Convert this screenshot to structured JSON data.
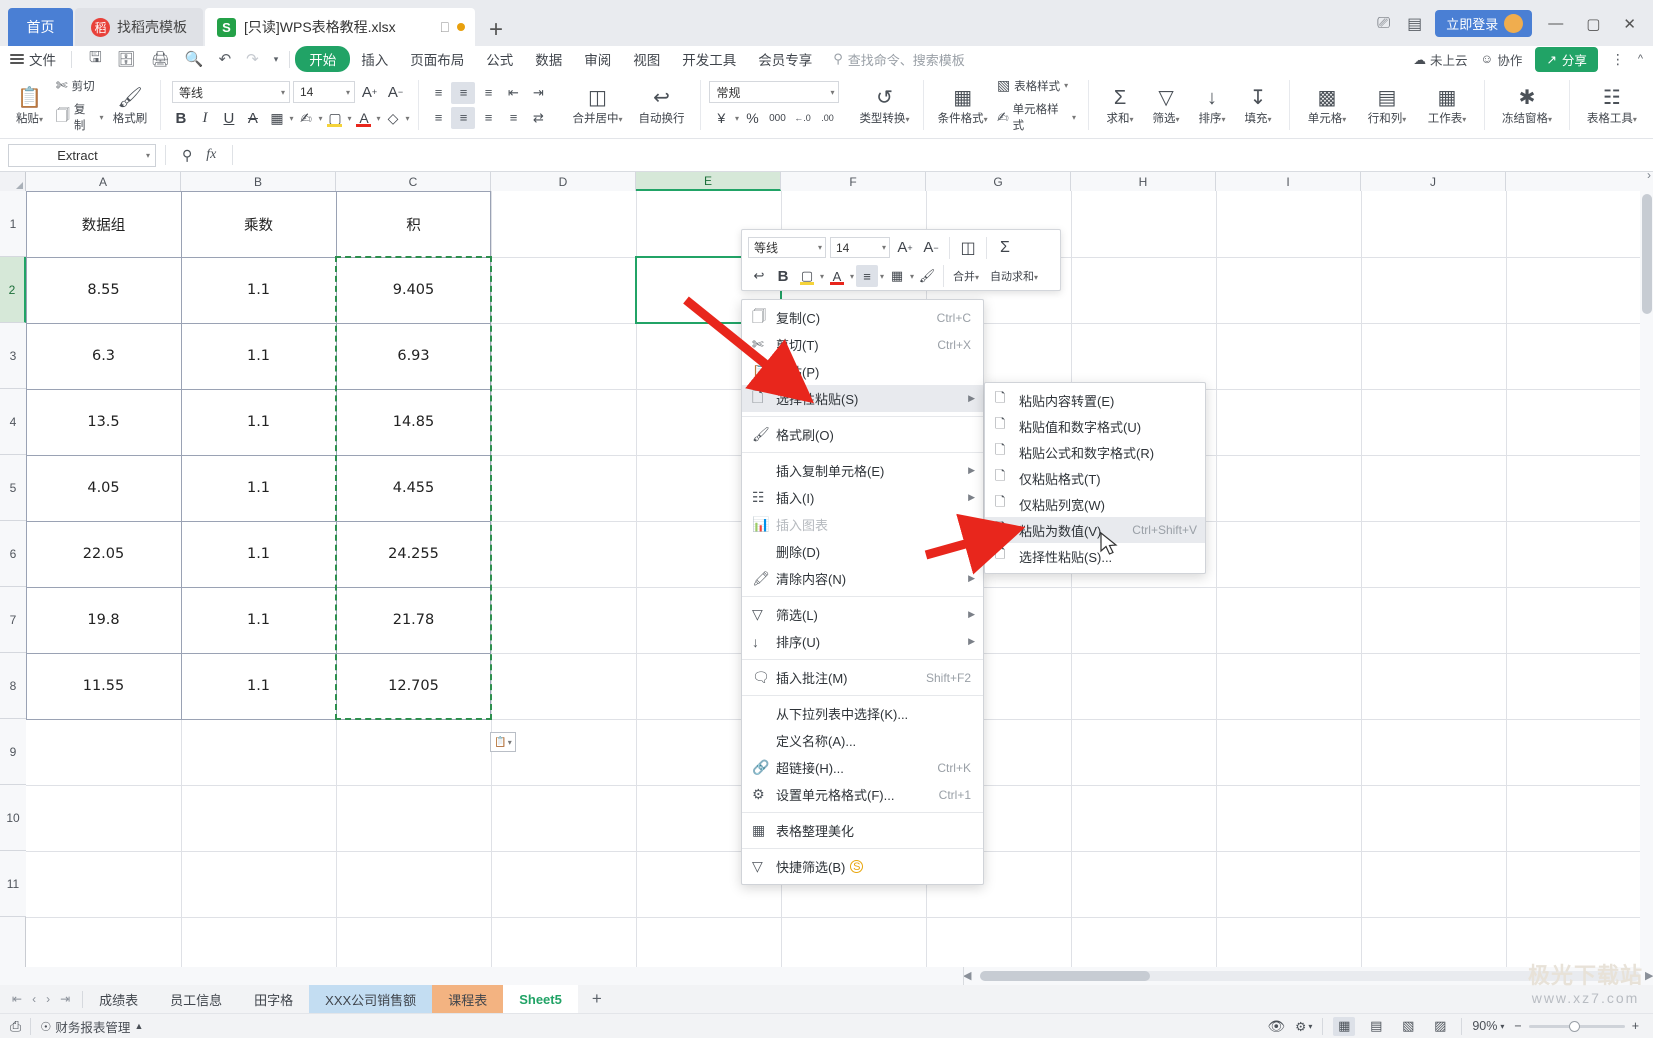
{
  "titlebar": {
    "home_tab": "首页",
    "template_tab": "找稻壳模板",
    "template_logo": "稻",
    "doc_tab": "[只读]WPS表格教程.xlsx",
    "doc_logo": "S",
    "new_tab_icon": "plus-icon",
    "login_label": "立即登录",
    "minimize": "—",
    "maximize": "▢",
    "close": "✕"
  },
  "menubar": {
    "file": "文件",
    "quick_access": [
      "save-icon",
      "save-as-icon",
      "print-icon",
      "print-preview-icon",
      "undo-icon",
      "redo-icon",
      "customize-icon"
    ],
    "items": [
      "开始",
      "插入",
      "页面布局",
      "公式",
      "数据",
      "审阅",
      "视图",
      "开发工具",
      "会员专享"
    ],
    "active_item": "开始",
    "search_placeholder": "查找命令、搜索模板",
    "cloud_status": "未上云",
    "collaborate": "协作",
    "share": "分享"
  },
  "ribbon": {
    "paste": "粘贴",
    "cut": "剪切",
    "copy": "复制",
    "format_painter": "格式刷",
    "font_name": "等线",
    "font_size": "14",
    "grow_font": "A+",
    "shrink_font": "A-",
    "bold": "B",
    "italic": "I",
    "underline": "U",
    "strikethrough": "A",
    "borders": "田",
    "borders_more": "边框",
    "highlight": "填充颜色",
    "font_color": "字体颜色",
    "clear_format": "清除格式",
    "merge_center": "合并居中",
    "wrap_text": "自动换行",
    "number_format": "常规",
    "currency": "¥",
    "percent": "%",
    "comma": "000",
    "dec_decrease": "←.0",
    "dec_increase": ".00",
    "type_convert": "类型转换",
    "cond_format": "条件格式",
    "table_style": "表格样式",
    "cell_style": "单元格样式",
    "autosum": "求和",
    "filter": "筛选",
    "sort": "排序",
    "fill": "填充",
    "cells": "单元格",
    "rows_cols": "行和列",
    "worksheet": "工作表",
    "freeze_panes": "冻结窗格",
    "table_tools": "表格工具"
  },
  "formula_bar": {
    "name_box": "Extract",
    "fx_label": "fx",
    "formula_value": "",
    "zoom_icon": "search-icon"
  },
  "grid": {
    "columns": [
      "A",
      "B",
      "C",
      "D",
      "E",
      "F",
      "G",
      "H",
      "I",
      "J"
    ],
    "selected_column": "E",
    "rows": [
      "1",
      "2",
      "3",
      "4",
      "5",
      "6",
      "7",
      "8",
      "9",
      "10",
      "11"
    ],
    "selected_row": "2",
    "headers": {
      "A": "数据组",
      "B": "乘数",
      "C": "积"
    },
    "data": [
      {
        "row": "2",
        "A": "8.55",
        "B": "1.1",
        "C": "9.405"
      },
      {
        "row": "3",
        "A": "6.3",
        "B": "1.1",
        "C": "6.93"
      },
      {
        "row": "4",
        "A": "13.5",
        "B": "1.1",
        "C": "14.85"
      },
      {
        "row": "5",
        "A": "4.05",
        "B": "1.1",
        "C": "4.455"
      },
      {
        "row": "6",
        "A": "22.05",
        "B": "1.1",
        "C": "24.255"
      },
      {
        "row": "7",
        "A": "19.8",
        "B": "1.1",
        "C": "21.78"
      },
      {
        "row": "8",
        "A": "11.55",
        "B": "1.1",
        "C": "12.705"
      }
    ],
    "copy_range": "C2:C8",
    "active_cell": "E2",
    "paste_options_icon": "paste-options-icon"
  },
  "mini_toolbar": {
    "font_name": "等线",
    "font_size": "14",
    "grow": "A+",
    "shrink": "A-",
    "merge": "合并",
    "autosum": "自动求和",
    "wrap_icon": "wrap-text-icon",
    "bold": "B",
    "highlight_icon": "highlight-icon",
    "font_color_icon": "font-color-icon",
    "align_icon": "align-center-icon",
    "border_icon": "borders-icon",
    "painter_icon": "format-painter-icon"
  },
  "context_menu": {
    "items": [
      {
        "label": "复制(C)",
        "shortcut": "Ctrl+C",
        "icon": "copy-icon",
        "arrow": false,
        "disabled": false,
        "highlight": false
      },
      {
        "label": "剪切(T)",
        "shortcut": "Ctrl+X",
        "icon": "cut-icon",
        "arrow": false,
        "disabled": false,
        "highlight": false
      },
      {
        "label": "粘贴(P)",
        "shortcut": "",
        "icon": "paste-icon",
        "arrow": false,
        "disabled": false,
        "highlight": false
      },
      {
        "label": "选择性粘贴(S)",
        "shortcut": "",
        "icon": "paste-special-icon",
        "arrow": true,
        "disabled": false,
        "highlight": true
      },
      {
        "label": "格式刷(O)",
        "shortcut": "",
        "icon": "format-painter-icon",
        "arrow": false,
        "disabled": false,
        "highlight": false
      },
      {
        "label": "插入复制单元格(E)",
        "shortcut": "",
        "icon": "",
        "arrow": true,
        "disabled": false,
        "highlight": false
      },
      {
        "label": "插入(I)",
        "shortcut": "",
        "icon": "insert-icon",
        "arrow": true,
        "disabled": false,
        "highlight": false
      },
      {
        "label": "插入图表",
        "shortcut": "",
        "icon": "chart-icon",
        "arrow": false,
        "disabled": true,
        "highlight": false
      },
      {
        "label": "删除(D)",
        "shortcut": "",
        "icon": "",
        "arrow": false,
        "disabled": false,
        "highlight": false
      },
      {
        "label": "清除内容(N)",
        "shortcut": "",
        "icon": "clear-icon",
        "arrow": true,
        "disabled": false,
        "highlight": false
      },
      {
        "label": "筛选(L)",
        "shortcut": "",
        "icon": "filter-icon",
        "arrow": true,
        "disabled": false,
        "highlight": false
      },
      {
        "label": "排序(U)",
        "shortcut": "",
        "icon": "sort-icon",
        "arrow": true,
        "disabled": false,
        "highlight": false
      },
      {
        "label": "插入批注(M)",
        "shortcut": "Shift+F2",
        "icon": "comment-icon",
        "arrow": false,
        "disabled": false,
        "highlight": false
      },
      {
        "label": "从下拉列表中选择(K)...",
        "shortcut": "",
        "icon": "",
        "arrow": false,
        "disabled": false,
        "highlight": false
      },
      {
        "label": "定义名称(A)...",
        "shortcut": "",
        "icon": "",
        "arrow": false,
        "disabled": false,
        "highlight": false
      },
      {
        "label": "超链接(H)...",
        "shortcut": "Ctrl+K",
        "icon": "link-icon",
        "arrow": false,
        "disabled": false,
        "highlight": false
      },
      {
        "label": "设置单元格格式(F)...",
        "shortcut": "Ctrl+1",
        "icon": "cell-format-icon",
        "arrow": false,
        "disabled": false,
        "highlight": false
      },
      {
        "label": "表格整理美化",
        "shortcut": "",
        "icon": "beautify-icon",
        "arrow": false,
        "disabled": false,
        "highlight": false
      },
      {
        "label": "快捷筛选(B)",
        "shortcut": "",
        "icon": "quick-filter-icon",
        "arrow": false,
        "disabled": false,
        "highlight": false,
        "badge": "S"
      }
    ],
    "separators_after": [
      3,
      4,
      9,
      11,
      12,
      16,
      17
    ]
  },
  "submenu": {
    "items": [
      {
        "label": "粘贴内容转置(E)",
        "shortcut": "",
        "icon": "transpose-icon",
        "highlight": false
      },
      {
        "label": "粘贴值和数字格式(U)",
        "shortcut": "",
        "icon": "paste-values-fmt-icon",
        "highlight": false
      },
      {
        "label": "粘贴公式和数字格式(R)",
        "shortcut": "",
        "icon": "paste-formula-icon",
        "highlight": false
      },
      {
        "label": "仅粘贴格式(T)",
        "shortcut": "",
        "icon": "paste-format-icon",
        "highlight": false
      },
      {
        "label": "仅粘贴列宽(W)",
        "shortcut": "",
        "icon": "paste-width-icon",
        "highlight": false
      },
      {
        "label": "粘贴为数值(V)",
        "shortcut": "Ctrl+Shift+V",
        "icon": "paste-value-icon",
        "highlight": true
      },
      {
        "label": "选择性粘贴(S)...",
        "shortcut": "",
        "icon": "paste-special-icon",
        "highlight": false
      }
    ]
  },
  "sheet_tabs": {
    "nav": [
      "first-sheet-icon",
      "prev-sheet-icon",
      "next-sheet-icon",
      "last-sheet-icon"
    ],
    "tabs": [
      {
        "label": "成绩表",
        "color": "none",
        "active": false
      },
      {
        "label": "员工信息",
        "color": "none",
        "active": false
      },
      {
        "label": "田字格",
        "color": "none",
        "active": false
      },
      {
        "label": "XXX公司销售额",
        "color": "blue",
        "active": false
      },
      {
        "label": "课程表",
        "color": "orange",
        "active": false
      },
      {
        "label": "Sheet5",
        "color": "none",
        "active": true
      }
    ],
    "add_sheet": "+",
    "tab_colors": {
      "blue": "#c3ddf2",
      "orange": "#f3b381",
      "active_text": "#21a366"
    }
  },
  "status_bar": {
    "record_icon": "macro-record-icon",
    "report_tool": "财务报表管理",
    "eye_icon": "eye-icon",
    "setting_icon": "settings-icon",
    "view_normal": "normal-view-icon",
    "view_layout": "page-layout-icon",
    "view_break": "page-break-icon",
    "view_read": "reading-view-icon",
    "zoom_level": "90%",
    "zoom_out": "−",
    "zoom_in": "+"
  },
  "watermark": {
    "line1": "极光下载站",
    "line2": "www.xz7.com"
  },
  "colors": {
    "accent_green": "#21a366",
    "tab_blue": "#4a7fd4",
    "copy_border": "#2d8f4e",
    "arrow_red": "#e8261c",
    "selection": "#d6e8d8"
  }
}
